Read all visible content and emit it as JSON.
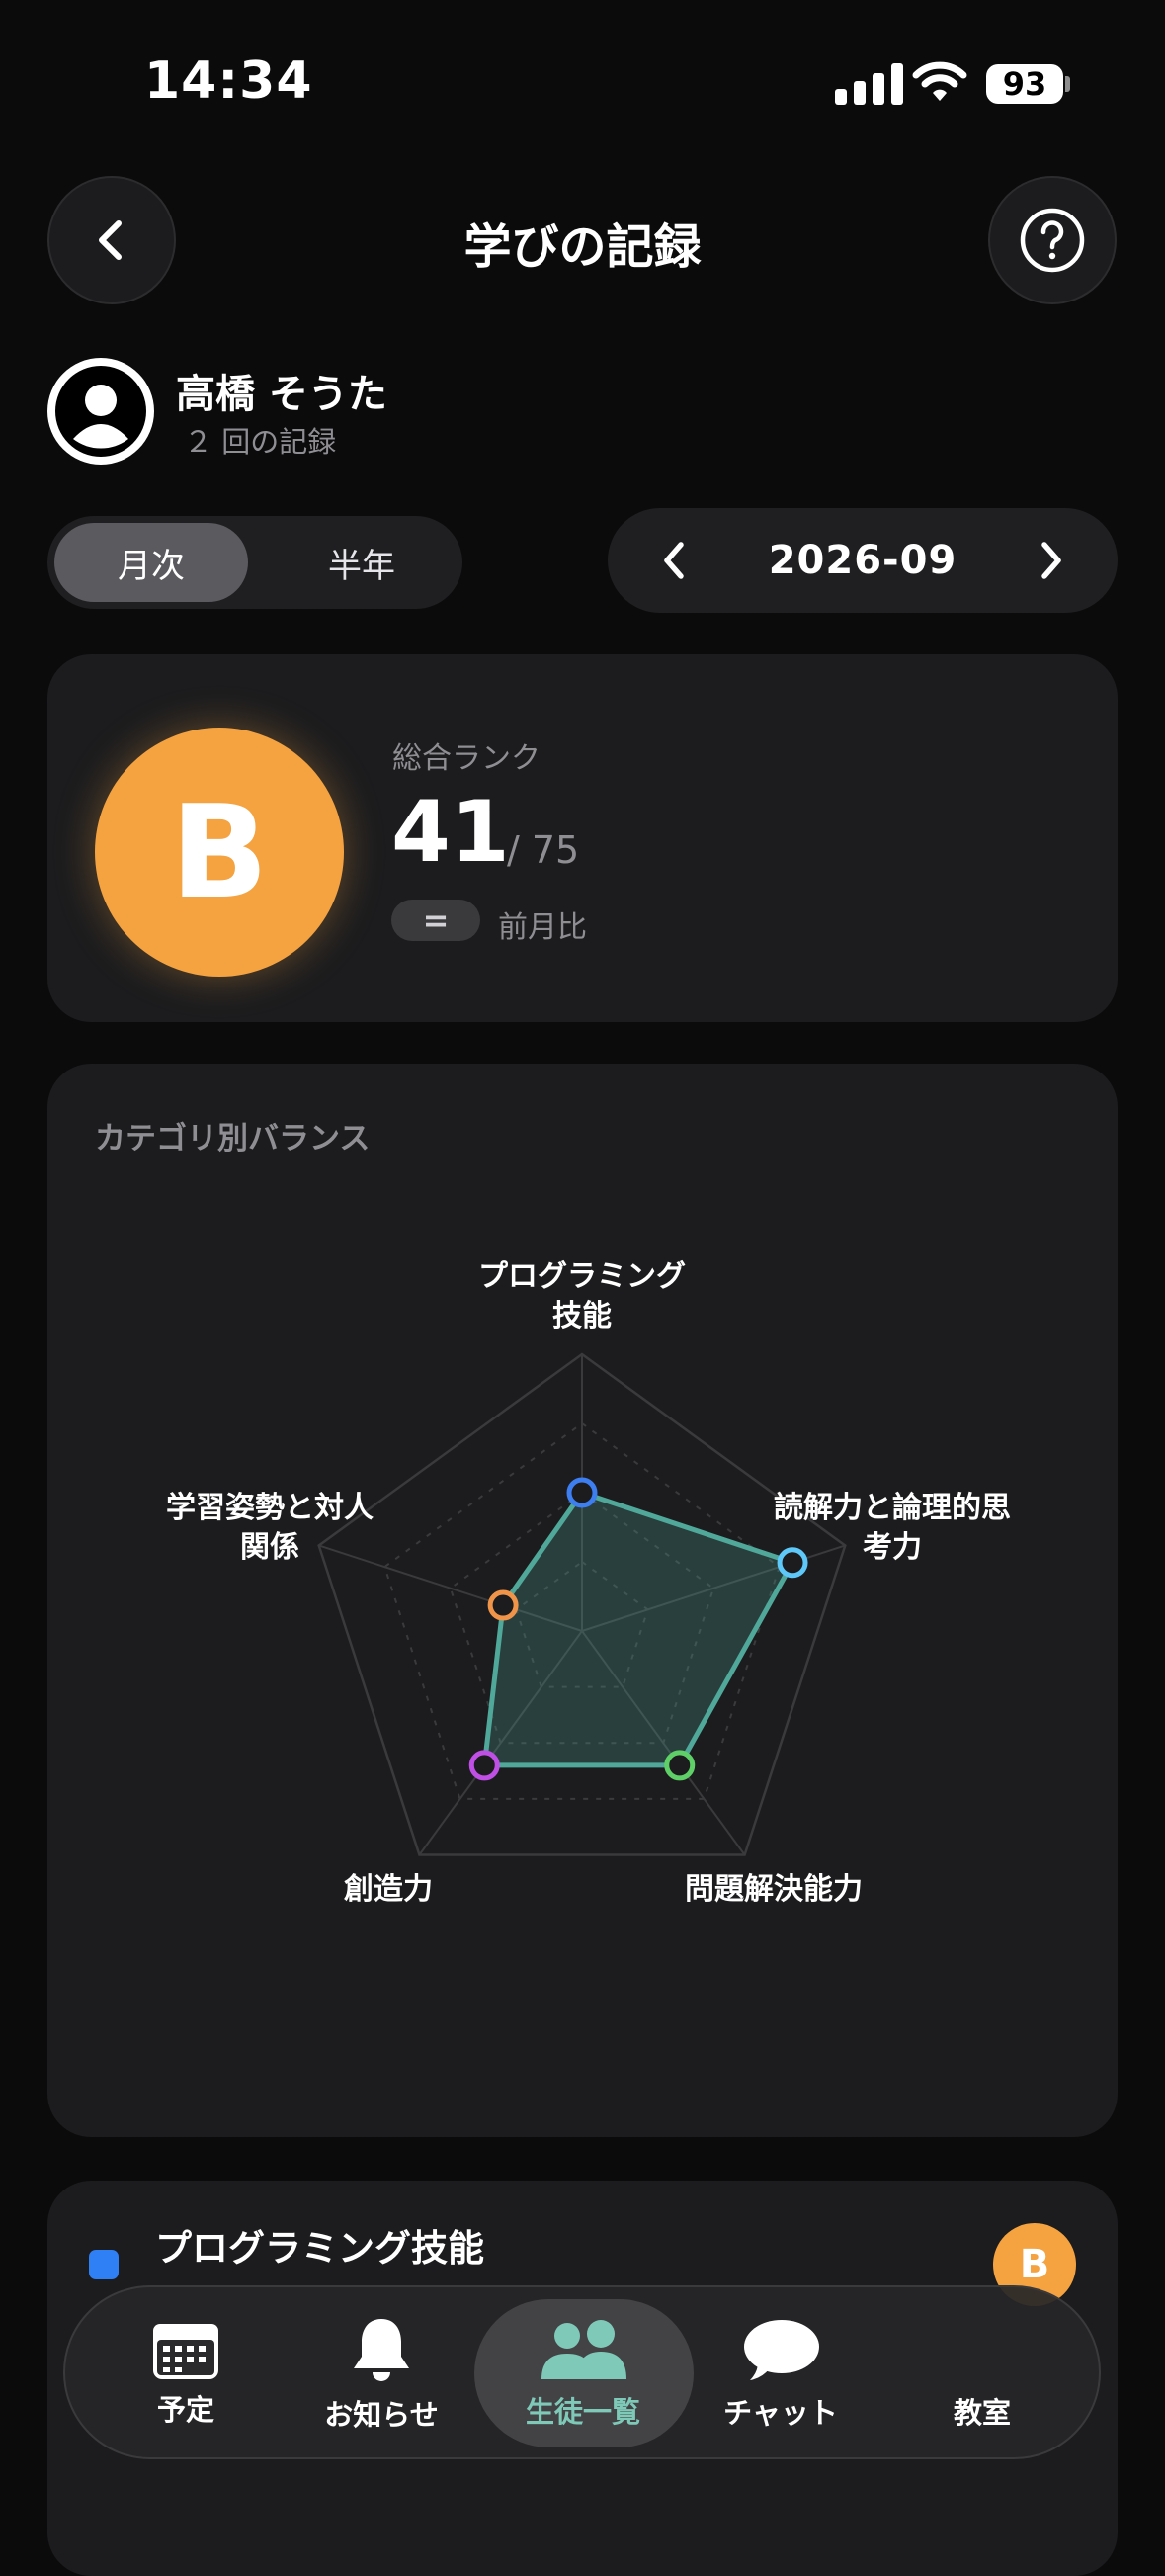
{
  "status": {
    "time": "14:34",
    "battery": "93"
  },
  "header": {
    "title": "学びの記録"
  },
  "profile": {
    "name": "高橋 そうた",
    "records": "２ 回の記録"
  },
  "period_toggle": {
    "options": [
      "月次",
      "半年"
    ],
    "selected": "月次"
  },
  "period": {
    "value": "2026-09"
  },
  "rank": {
    "grade": "B",
    "label": "総合ランク",
    "position": "41",
    "total": "/ 75",
    "change_symbol": "=",
    "change_label": "前月比"
  },
  "balance": {
    "title": "カテゴリ別バランス",
    "axes": [
      {
        "label_lines": [
          "プログラミング",
          "技能"
        ],
        "value": 0.5,
        "color": "#3d7ef0"
      },
      {
        "label_lines": [
          "読解力と論理的思",
          "考力"
        ],
        "value": 0.8,
        "color": "#5ec8f8"
      },
      {
        "label_lines": [
          "問題解決能力"
        ],
        "value": 0.6,
        "color": "#5fd068"
      },
      {
        "label_lines": [
          "創造力"
        ],
        "value": 0.6,
        "color": "#c04fe6"
      },
      {
        "label_lines": [
          "学習姿勢と対人",
          "関係"
        ],
        "value": 0.3,
        "color": "#f0944a"
      }
    ],
    "fill_color": "#4fa89a"
  },
  "category_row": {
    "title": "プログラミング技能",
    "grade": "B",
    "color": "#2f7ff5"
  },
  "tabbar": {
    "tabs": [
      {
        "label": "予定",
        "icon": "calendar-icon"
      },
      {
        "label": "お知らせ",
        "icon": "bell-icon"
      },
      {
        "label": "生徒一覧",
        "icon": "people-icon",
        "active": true
      },
      {
        "label": "チャット",
        "icon": "chat-icon"
      },
      {
        "label": "教室",
        "icon": "classroom-icon"
      }
    ],
    "active_color": "#7fc9b9"
  }
}
